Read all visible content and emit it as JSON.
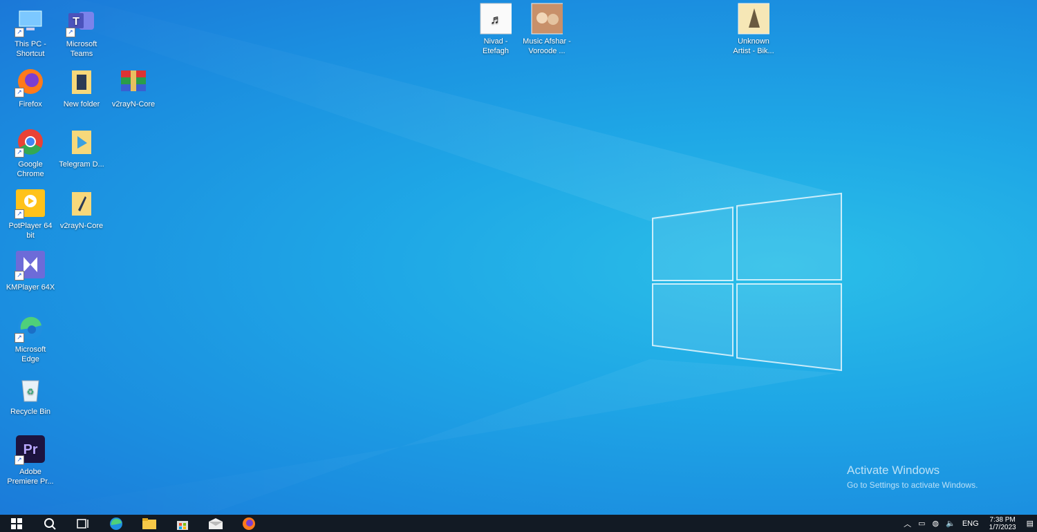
{
  "desktop_icons": [
    {
      "label": "This PC - Shortcut",
      "icon": "this-pc-icon",
      "shortcut": true
    },
    {
      "label": "Microsoft Teams",
      "icon": "teams-icon",
      "shortcut": true
    },
    {
      "label": "Firefox",
      "icon": "firefox-icon",
      "shortcut": true
    },
    {
      "label": "New folder",
      "icon": "folder-icon",
      "shortcut": false
    },
    {
      "label": "v2rayN-Core",
      "icon": "winrar-archive-icon",
      "shortcut": false
    },
    {
      "label": "Google Chrome",
      "icon": "chrome-icon",
      "shortcut": true
    },
    {
      "label": "Telegram D...",
      "icon": "folder-icon",
      "shortcut": false
    },
    {
      "label": "PotPlayer 64 bit",
      "icon": "potplayer-icon",
      "shortcut": true
    },
    {
      "label": "v2rayN-Core",
      "icon": "folder-icon",
      "shortcut": false
    },
    {
      "label": "KMPlayer 64X",
      "icon": "kmplayer-icon",
      "shortcut": true
    },
    {
      "label": "Microsoft Edge",
      "icon": "edge-icon",
      "shortcut": true
    },
    {
      "label": "Recycle Bin",
      "icon": "recycle-bin-icon",
      "shortcut": false
    },
    {
      "label": "Adobe Premiere Pr...",
      "icon": "premiere-icon",
      "shortcut": true
    },
    {
      "label": "Nivad - Etefagh",
      "icon": "music-cover-icon",
      "shortcut": false
    },
    {
      "label": "Music Afshar - Voroode ...",
      "icon": "music-cover-icon",
      "shortcut": false
    },
    {
      "label": "Unknown Artist - Bik...",
      "icon": "music-cover-icon",
      "shortcut": false
    }
  ],
  "watermark": {
    "title": "Activate Windows",
    "subtitle": "Go to Settings to activate Windows."
  },
  "taskbar": {
    "buttons": [
      "start",
      "search",
      "task-view",
      "edge",
      "file-explorer",
      "store",
      "mail",
      "firefox"
    ]
  },
  "tray": {
    "language": "ENG",
    "time": "7:38 PM",
    "date": "1/7/2023"
  },
  "colors": {
    "wallpaper": "#1fa8e6",
    "taskbar": "#121a24"
  }
}
